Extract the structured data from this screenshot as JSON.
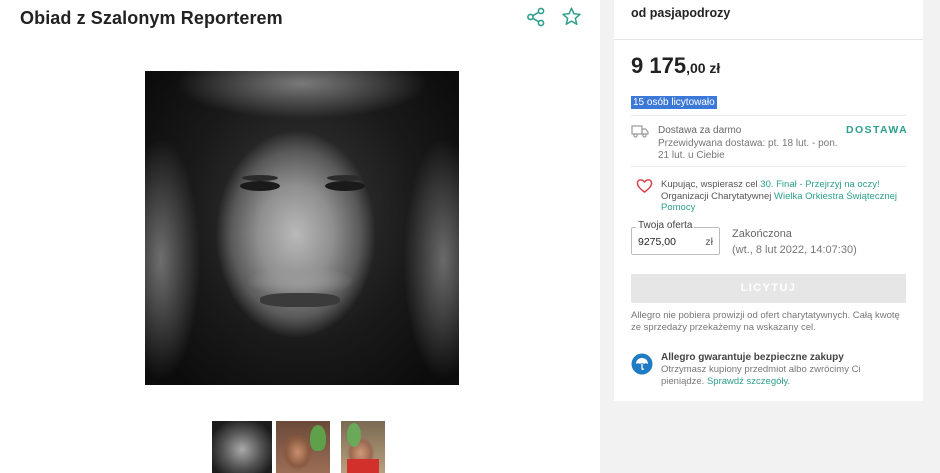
{
  "product": {
    "title": "Obiad z Szalonym Reporterem",
    "icons": [
      "share-icon",
      "star-icon"
    ],
    "main_image": "portrait-photo-black-white",
    "thumbnails": [
      "portrait-bw",
      "man-with-leaves",
      "man-with-leaves-red-shirt"
    ]
  },
  "sidebar": {
    "seller": "od pasjapodrozy",
    "price_int": "9 175",
    "price_dec": ",00 zł",
    "bidders": "15 osób licytowało",
    "delivery": {
      "title": "Dostawa za darmo",
      "estimate": "Przewidywana dostawa: pt. 18 lut. - pon. 21 lut. u Ciebie",
      "label": "DOSTAWA"
    },
    "charity": {
      "prefix": "Kupując, wspierasz cel ",
      "cause_link": "30. Finał - Przejrzyj na oczy!",
      "middle": " Organizacji Charytatywnej ",
      "org_link": "Wielka Orkiestra Świątecznej Pomocy"
    },
    "offer": {
      "legend": "Twoja oferta",
      "value": "9275,00",
      "currency": "zł"
    },
    "status": "Zakończona",
    "status_date": "(wt., 8 lut 2022, 14:07:30)",
    "bid_button": "LICYTUJ",
    "no_commission": "Allegro nie pobiera prowizji od ofert charytatywnych. Całą kwotę ze sprzedaży przekażemy na wskazany cel.",
    "guarantee": {
      "title": "Allegro gwarantuje bezpieczne zakupy",
      "text": "Otrzymasz kupiony przedmiot albo zwrócimy Ci pieniądze. ",
      "link": "Sprawdź szczegóły."
    }
  },
  "colors": {
    "accent": "#2d9f8c",
    "heart": "#d9434d",
    "shield": "#1f7bc2",
    "selection": "#3c78d8"
  }
}
